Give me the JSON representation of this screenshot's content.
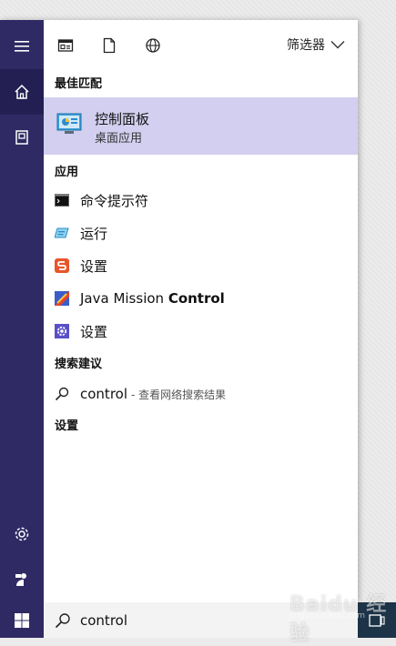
{
  "filter": {
    "label": "筛选器"
  },
  "sections": {
    "best_match": "最佳匹配",
    "apps": "应用",
    "web": "搜索建议",
    "settings": "设置"
  },
  "best_match": {
    "title": "控制面板",
    "subtitle": "桌面应用"
  },
  "apps": [
    {
      "label": "命令提示符",
      "icon": "cmd-icon"
    },
    {
      "label": "运行",
      "icon": "run-icon"
    },
    {
      "label": "设置",
      "icon": "sogou-settings-icon"
    },
    {
      "label_prefix": "Java Mission ",
      "label_bold": "Control",
      "icon": "java-mission-control-icon"
    },
    {
      "label": "设置",
      "icon": "settings-gear-icon"
    }
  ],
  "web_suggestion": {
    "query": "control",
    "hint": "- 查看网络搜索结果"
  },
  "search": {
    "value": "control"
  },
  "watermark": {
    "text": "Baidu 经验",
    "url": "jingyan.baidu.com"
  },
  "colors": {
    "rail": "#2f2a63",
    "highlight": "#d2cff0",
    "accent": "#6a5fc1"
  }
}
